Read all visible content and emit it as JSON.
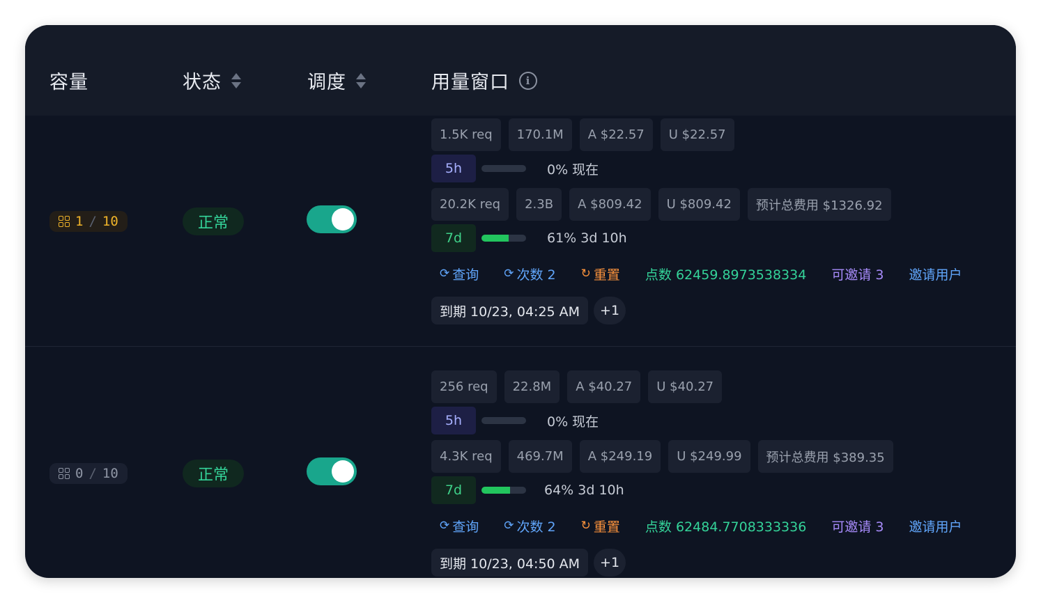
{
  "header": {
    "capacity": "容量",
    "status": "状态",
    "schedule": "调度",
    "usage_window": "用量窗口"
  },
  "rows": [
    {
      "capacity": {
        "used": "1",
        "sep": "/",
        "total": "10"
      },
      "status": "正常",
      "schedule_enabled": true,
      "window_5h": {
        "chips": [
          "1.5K req",
          "170.1M",
          "A $22.57",
          "U $22.57"
        ],
        "label": "5h",
        "progress": 0,
        "text": "0% 现在"
      },
      "window_7d": {
        "chips": [
          "20.2K req",
          "2.3B",
          "A $809.42",
          "U $809.42",
          "预计总费用 $1326.92"
        ],
        "label": "7d",
        "progress": 61,
        "text": "61% 3d 10h"
      },
      "actions": {
        "query": "查询",
        "count": "次数 2",
        "reset": "重置",
        "points": "点数 62459.8973538334",
        "invitable": "可邀请 3",
        "invite": "邀请用户"
      },
      "expiry": "到期 10/23, 04:25 AM",
      "more": "+1"
    },
    {
      "capacity": {
        "used": "0",
        "sep": "/",
        "total": "10"
      },
      "status": "正常",
      "schedule_enabled": true,
      "window_5h": {
        "chips": [
          "256 req",
          "22.8M",
          "A $40.27",
          "U $40.27"
        ],
        "label": "5h",
        "progress": 0,
        "text": "0% 现在"
      },
      "window_7d": {
        "chips": [
          "4.3K req",
          "469.7M",
          "A $249.19",
          "U $249.99",
          "预计总费用 $389.35"
        ],
        "label": "7d",
        "progress": 64,
        "text": "64% 3d 10h"
      },
      "actions": {
        "query": "查询",
        "count": "次数 2",
        "reset": "重置",
        "points": "点数 62484.7708333336",
        "invitable": "可邀请 3",
        "invite": "邀请用户"
      },
      "expiry": "到期 10/23, 04:50 AM",
      "more": "+1"
    }
  ]
}
